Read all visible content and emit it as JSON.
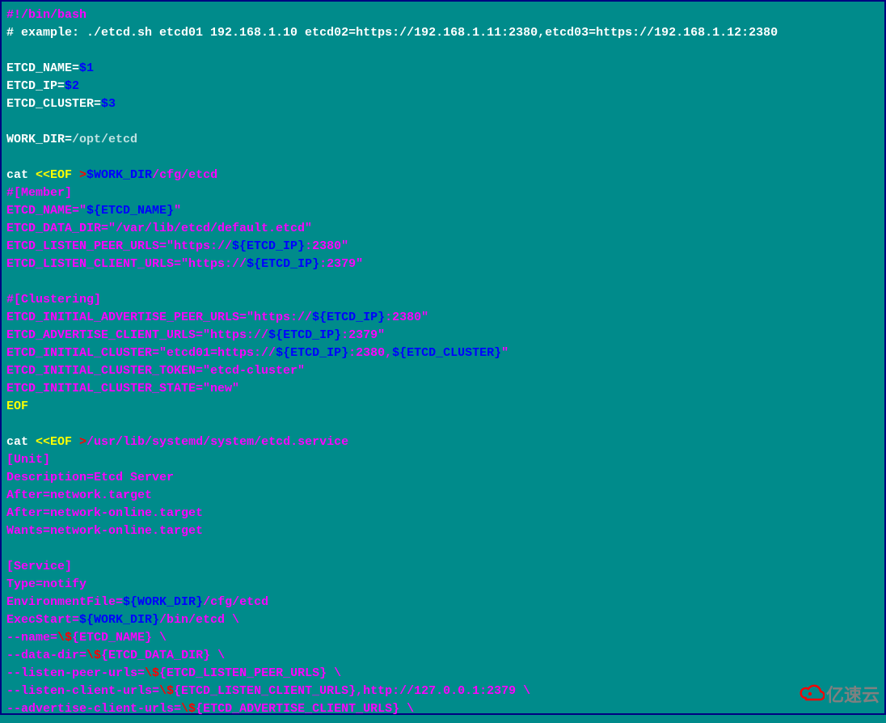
{
  "lines": [
    {
      "segments": [
        {
          "cls": "c-magenta",
          "text": "#!/bin/bash"
        }
      ]
    },
    {
      "segments": [
        {
          "cls": "c-white",
          "text": "# example: ./etcd.sh etcd01 192.168.1.10 etcd02=https://192.168.1.11:2380,etcd03=https://192.168.1.12:2380"
        }
      ]
    },
    {
      "segments": []
    },
    {
      "segments": [
        {
          "cls": "c-white",
          "text": "ETCD_NAME="
        },
        {
          "cls": "c-blue",
          "text": "$1"
        }
      ]
    },
    {
      "segments": [
        {
          "cls": "c-white",
          "text": "ETCD_IP="
        },
        {
          "cls": "c-blue",
          "text": "$2"
        }
      ]
    },
    {
      "segments": [
        {
          "cls": "c-white",
          "text": "ETCD_CLUSTER="
        },
        {
          "cls": "c-blue",
          "text": "$3"
        }
      ]
    },
    {
      "segments": []
    },
    {
      "segments": [
        {
          "cls": "c-white",
          "text": "WORK_DIR="
        },
        {
          "cls": "c-lightgray",
          "text": "/opt/etcd"
        }
      ]
    },
    {
      "segments": []
    },
    {
      "segments": [
        {
          "cls": "c-white",
          "text": "cat "
        },
        {
          "cls": "c-yellow",
          "text": "<<EOF "
        },
        {
          "cls": "c-red",
          "text": ">"
        },
        {
          "cls": "c-blue",
          "text": "$WORK_DIR"
        },
        {
          "cls": "c-magenta",
          "text": "/cfg/etcd"
        }
      ]
    },
    {
      "segments": [
        {
          "cls": "c-magenta",
          "text": "#[Member]"
        }
      ]
    },
    {
      "segments": [
        {
          "cls": "c-magenta",
          "text": "ETCD_NAME=\""
        },
        {
          "cls": "c-blue",
          "text": "${ETCD_NAME}"
        },
        {
          "cls": "c-magenta",
          "text": "\""
        }
      ]
    },
    {
      "segments": [
        {
          "cls": "c-magenta",
          "text": "ETCD_DATA_DIR=\"/var/lib/etcd/default.etcd\""
        }
      ]
    },
    {
      "segments": [
        {
          "cls": "c-magenta",
          "text": "ETCD_LISTEN_PEER_URLS=\"https://"
        },
        {
          "cls": "c-blue",
          "text": "${ETCD_IP}"
        },
        {
          "cls": "c-magenta",
          "text": ":2380\""
        }
      ]
    },
    {
      "segments": [
        {
          "cls": "c-magenta",
          "text": "ETCD_LISTEN_CLIENT_URLS=\"https://"
        },
        {
          "cls": "c-blue",
          "text": "${ETCD_IP}"
        },
        {
          "cls": "c-magenta",
          "text": ":2379\""
        }
      ]
    },
    {
      "segments": []
    },
    {
      "segments": [
        {
          "cls": "c-magenta",
          "text": "#[Clustering]"
        }
      ]
    },
    {
      "segments": [
        {
          "cls": "c-magenta",
          "text": "ETCD_INITIAL_ADVERTISE_PEER_URLS=\"https://"
        },
        {
          "cls": "c-blue",
          "text": "${ETCD_IP}"
        },
        {
          "cls": "c-magenta",
          "text": ":2380\""
        }
      ]
    },
    {
      "segments": [
        {
          "cls": "c-magenta",
          "text": "ETCD_ADVERTISE_CLIENT_URLS=\"https://"
        },
        {
          "cls": "c-blue",
          "text": "${ETCD_IP}"
        },
        {
          "cls": "c-magenta",
          "text": ":2379\""
        }
      ]
    },
    {
      "segments": [
        {
          "cls": "c-magenta",
          "text": "ETCD_INITIAL_CLUSTER=\"etcd01=https://"
        },
        {
          "cls": "c-blue",
          "text": "${ETCD_IP}"
        },
        {
          "cls": "c-magenta",
          "text": ":2380,"
        },
        {
          "cls": "c-blue",
          "text": "${ETCD_CLUSTER}"
        },
        {
          "cls": "c-magenta",
          "text": "\""
        }
      ]
    },
    {
      "segments": [
        {
          "cls": "c-magenta",
          "text": "ETCD_INITIAL_CLUSTER_TOKEN=\"etcd-cluster\""
        }
      ]
    },
    {
      "segments": [
        {
          "cls": "c-magenta",
          "text": "ETCD_INITIAL_CLUSTER_STATE=\"new\""
        }
      ]
    },
    {
      "segments": [
        {
          "cls": "c-yellow",
          "text": "EOF"
        }
      ]
    },
    {
      "segments": []
    },
    {
      "segments": [
        {
          "cls": "c-white",
          "text": "cat "
        },
        {
          "cls": "c-yellow",
          "text": "<<EOF "
        },
        {
          "cls": "c-red",
          "text": ">"
        },
        {
          "cls": "c-magenta",
          "text": "/usr/lib/systemd/system/etcd.service"
        }
      ]
    },
    {
      "segments": [
        {
          "cls": "c-magenta",
          "text": "[Unit]"
        }
      ]
    },
    {
      "segments": [
        {
          "cls": "c-magenta",
          "text": "Description=Etcd Server"
        }
      ]
    },
    {
      "segments": [
        {
          "cls": "c-magenta",
          "text": "After=network.target"
        }
      ]
    },
    {
      "segments": [
        {
          "cls": "c-magenta",
          "text": "After=network-online.target"
        }
      ]
    },
    {
      "segments": [
        {
          "cls": "c-magenta",
          "text": "Wants=network-online.target"
        }
      ]
    },
    {
      "segments": []
    },
    {
      "segments": [
        {
          "cls": "c-magenta",
          "text": "[Service]"
        }
      ]
    },
    {
      "segments": [
        {
          "cls": "c-magenta",
          "text": "Type=notify"
        }
      ]
    },
    {
      "segments": [
        {
          "cls": "c-magenta",
          "text": "EnvironmentFile="
        },
        {
          "cls": "c-blue",
          "text": "${WORK_DIR}"
        },
        {
          "cls": "c-magenta",
          "text": "/cfg/etcd"
        }
      ]
    },
    {
      "segments": [
        {
          "cls": "c-magenta",
          "text": "ExecStart="
        },
        {
          "cls": "c-blue",
          "text": "${WORK_DIR}"
        },
        {
          "cls": "c-magenta",
          "text": "/bin/etcd \\"
        }
      ]
    },
    {
      "segments": [
        {
          "cls": "c-magenta",
          "text": "--name="
        },
        {
          "cls": "c-red",
          "text": "\\$"
        },
        {
          "cls": "c-magenta",
          "text": "{ETCD_NAME} \\"
        }
      ]
    },
    {
      "segments": [
        {
          "cls": "c-magenta",
          "text": "--data-dir="
        },
        {
          "cls": "c-red",
          "text": "\\$"
        },
        {
          "cls": "c-magenta",
          "text": "{ETCD_DATA_DIR} \\"
        }
      ]
    },
    {
      "segments": [
        {
          "cls": "c-magenta",
          "text": "--listen-peer-urls="
        },
        {
          "cls": "c-red",
          "text": "\\$"
        },
        {
          "cls": "c-magenta",
          "text": "{ETCD_LISTEN_PEER_URLS} \\"
        }
      ]
    },
    {
      "segments": [
        {
          "cls": "c-magenta",
          "text": "--listen-client-urls="
        },
        {
          "cls": "c-red",
          "text": "\\$"
        },
        {
          "cls": "c-magenta",
          "text": "{ETCD_LISTEN_CLIENT_URLS},http://127.0.0.1:2379 \\"
        }
      ]
    },
    {
      "segments": [
        {
          "cls": "c-magenta",
          "text": "--advertise-client-urls="
        },
        {
          "cls": "c-red",
          "text": "\\$"
        },
        {
          "cls": "c-magenta",
          "text": "{ETCD_ADVERTISE_CLIENT_URLS} \\"
        }
      ]
    }
  ],
  "watermark": "亿速云"
}
